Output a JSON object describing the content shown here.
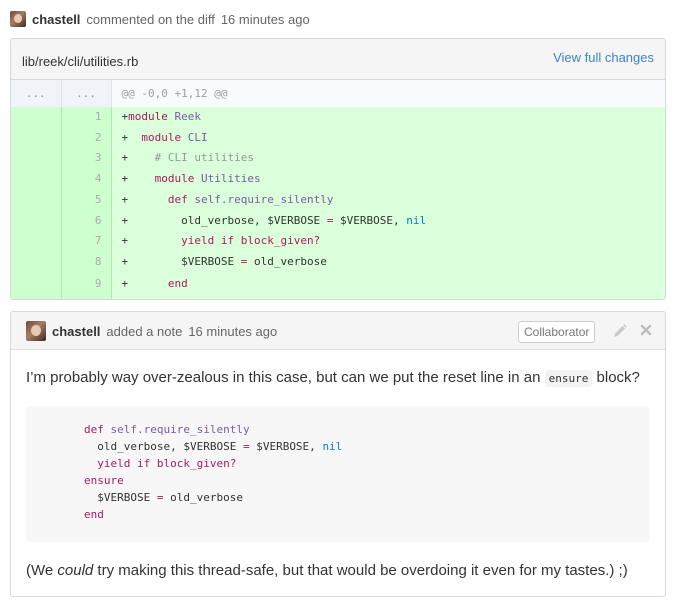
{
  "commit_comment": {
    "author": "chastell",
    "action": "commented on the diff",
    "time": "16 minutes ago"
  },
  "diff": {
    "file_path": "lib/reek/cli/utilities.rb",
    "view_full_label": "View full changes",
    "hunk": {
      "old_num": "...",
      "new_num": "...",
      "text": "@@ -0,0 +1,12 @@"
    },
    "lines": [
      {
        "num": "1",
        "prefix": "+",
        "segments": [
          {
            "t": "module ",
            "c": "kw"
          },
          {
            "t": "Reek",
            "c": "cls"
          }
        ]
      },
      {
        "num": "2",
        "prefix": "+  ",
        "segments": [
          {
            "t": "module ",
            "c": "kw"
          },
          {
            "t": "CLI",
            "c": "cls"
          }
        ]
      },
      {
        "num": "3",
        "prefix": "+    ",
        "segments": [
          {
            "t": "# CLI utilities",
            "c": "cm"
          }
        ]
      },
      {
        "num": "4",
        "prefix": "+    ",
        "segments": [
          {
            "t": "module ",
            "c": "kw"
          },
          {
            "t": "Utilities",
            "c": "cls"
          }
        ]
      },
      {
        "num": "5",
        "prefix": "+      ",
        "segments": [
          {
            "t": "def ",
            "c": "kw"
          },
          {
            "t": "self.require_silently",
            "c": "cls"
          }
        ]
      },
      {
        "num": "6",
        "prefix": "+        ",
        "segments": [
          {
            "t": "old_verbose, $VERBOSE ",
            "c": ""
          },
          {
            "t": "=",
            "c": "op"
          },
          {
            "t": " $VERBOSE, ",
            "c": ""
          },
          {
            "t": "nil",
            "c": "cn"
          }
        ]
      },
      {
        "num": "7",
        "prefix": "+        ",
        "segments": [
          {
            "t": "yield if block_given?",
            "c": "kw"
          }
        ]
      },
      {
        "num": "8",
        "prefix": "+        ",
        "segments": [
          {
            "t": "$VERBOSE ",
            "c": ""
          },
          {
            "t": "=",
            "c": "op"
          },
          {
            "t": " old_verbose",
            "c": ""
          }
        ]
      },
      {
        "num": "9",
        "prefix": "+      ",
        "segments": [
          {
            "t": "end",
            "c": "kw"
          }
        ]
      }
    ]
  },
  "note": {
    "author": "chastell",
    "action": "added a note",
    "time": "16 minutes ago",
    "badge": "Collaborator",
    "body_before": "I’m probably way over-zealous in this case, but can we put the reset line in an ",
    "body_code": "ensure",
    "body_after": " block?",
    "code_lines": [
      {
        "indent": "",
        "segments": [
          {
            "t": "def ",
            "c": "kw"
          },
          {
            "t": "self.require_silently",
            "c": "cls"
          }
        ]
      },
      {
        "indent": "  ",
        "segments": [
          {
            "t": "old_verbose, $VERBOSE ",
            "c": ""
          },
          {
            "t": "=",
            "c": "op"
          },
          {
            "t": " $VERBOSE, ",
            "c": ""
          },
          {
            "t": "nil",
            "c": "cn"
          }
        ]
      },
      {
        "indent": "  ",
        "segments": [
          {
            "t": "yield if block_given?",
            "c": "kw"
          }
        ]
      },
      {
        "indent": "",
        "segments": [
          {
            "t": "ensure",
            "c": "kw"
          }
        ]
      },
      {
        "indent": "  ",
        "segments": [
          {
            "t": "$VERBOSE ",
            "c": ""
          },
          {
            "t": "=",
            "c": "op"
          },
          {
            "t": " old_verbose",
            "c": ""
          }
        ]
      },
      {
        "indent": "",
        "segments": [
          {
            "t": "end",
            "c": "kw"
          }
        ]
      }
    ],
    "footer_before": "(We ",
    "footer_emph": "could",
    "footer_after": " try making this thread-safe, but that would be overdoing it even for my tastes.) ;)"
  },
  "icons": {
    "edit": "pencil-icon",
    "delete": "close-icon"
  },
  "colors": {
    "addition_bg": "#dbffdb",
    "link": "#4183c4"
  }
}
